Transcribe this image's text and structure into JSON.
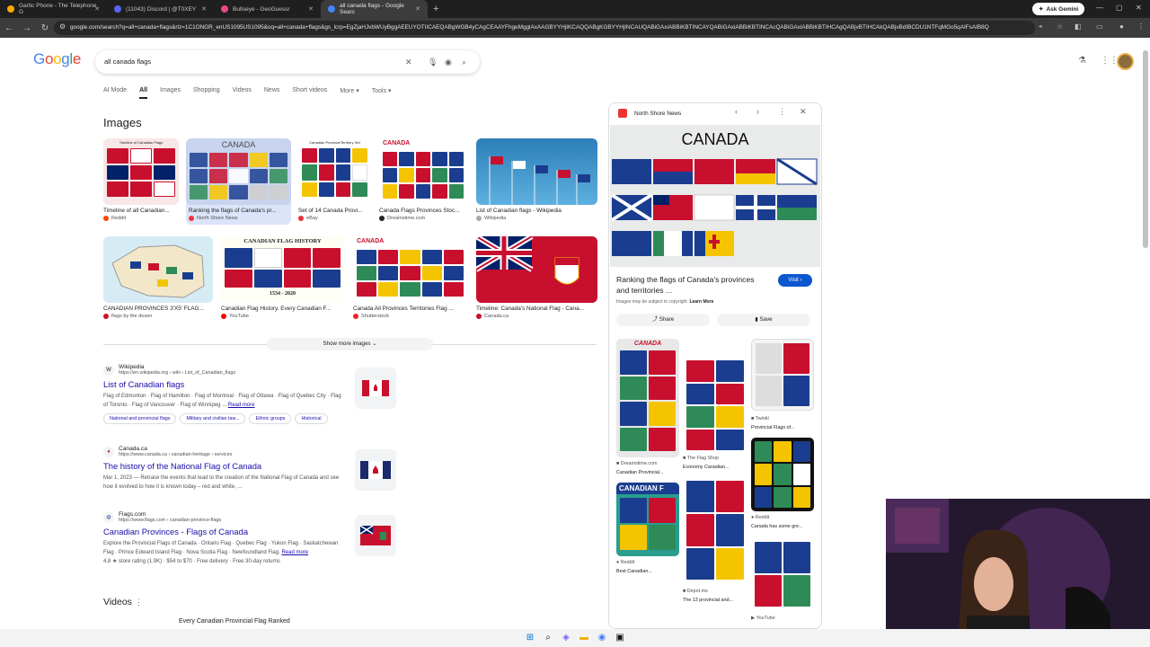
{
  "browser": {
    "tabs": [
      {
        "label": "Gartic Phone - The Telephone G",
        "color": "#f9ab00"
      },
      {
        "label": "(11043) Discord | @T0XEY",
        "color": "#5865f2"
      },
      {
        "label": "Bullseye - GeoGuessr",
        "color": "#e8488a"
      },
      {
        "label": "all canada flags - Google Searc",
        "color": "#4285f4"
      }
    ],
    "new_tab": "+",
    "ask_gemini": "Ask Gemini",
    "url": "google.com/search?q=all+canada+flags&rlz=1C1ONGR_enUS1095US1095&oq=all+canada+flags&gs_lcrp=EgZjaHJvbWUyBggAEEUYOTIICAEQABgWGB4yCAgCEAAYFhgeMgglAxAAGBYYHjIKCAQQABgKGBYYHjINCAUQABiGAxiABBiKBTINCAYQABiGAxiABBiKBTINCAcQABiGAxiABBiKBTIHCAgQABjvBTIHCAkQABjvBdIBCDU1NTFqMGo5qAIFsAIB8Q"
  },
  "google": {
    "logo": [
      "G",
      "o",
      "o",
      "g",
      "l",
      "e"
    ],
    "search_value": "all canada flags",
    "nav": [
      "AI Mode",
      "All",
      "Images",
      "Shopping",
      "Videos",
      "News",
      "Short videos",
      "More",
      "Tools"
    ],
    "images_heading": "Images",
    "image_results": [
      {
        "caption": "Timeline of all Canadian...",
        "source": "Reddit"
      },
      {
        "caption": "Ranking the flags of Canada's pr...",
        "source": "North Shore News"
      },
      {
        "caption": "Set of 14 Canada Provi...",
        "source": "eBay"
      },
      {
        "caption": "Canada Flags Provinces Stoc...",
        "source": "Dreamstime.com"
      },
      {
        "caption": "List of Canadian flags - Wikipedia",
        "source": "Wikipedia"
      },
      {
        "caption": "CANADIAN PROVINCES 3'X5' FLAG...",
        "source": "flags by the dozen"
      },
      {
        "caption": "Canadian Flag History. Every Canadian F...",
        "source": "YouTube"
      },
      {
        "caption": "Canada All Provinces Territories Flag ...",
        "source": "Shutterstock"
      },
      {
        "caption": "Timeline: Canada's National Flag - Cana...",
        "source": "Canada.ca"
      }
    ],
    "thumb_text": {
      "canada": "CANADA",
      "timeline": "Timeline of Canadian Flags",
      "set14": "Canadian Province/Territory Set",
      "history": "CANADIAN FLAG HISTORY",
      "years": "1534 - 2020"
    },
    "show_more": "Show more images",
    "results": [
      {
        "site": "Wikipedia",
        "url": "https://en.wikipedia.org › wiki › List_of_Canadian_flags",
        "title": "List of Canadian flags",
        "snippet": "Flag of Edmonton · Flag of Hamilton · Flag of Montreal · Flag of Ottawa · Flag of Quebec City · Flag of Toronto · Flag of Vancouver · Flag of Winnipeg ...",
        "read_more": "Read more",
        "chips": [
          "National and provincial flags",
          "Military and civilian law...",
          "Ethnic groups",
          "Historical"
        ]
      },
      {
        "site": "Canada.ca",
        "url": "https://www.canada.ca › canadian-heritage › services",
        "title": "The history of the National Flag of Canada",
        "snippet": "Mar 1, 2023 — Retrace the events that lead to the creation of the National Flag of Canada and see how it evolved to how it is known today – red and white, ..."
      },
      {
        "site": "Flags.com",
        "url": "https://www.flags.com › canadian-province-flags",
        "title": "Canadian Provinces - Flags of Canada",
        "snippet": "Explore the Provincial Flags of Canada · Ontario Flag · Quebec Flag · Yukon Flag · Saskatchewan Flag · Prince Edward Island Flag · Nova Scotia Flag · Newfoundland Flag.",
        "read_more": "Read more",
        "rating": "4.8 ★ store rating (1.9K) · $54 to $70 · Free delivery · Free 30-day returns"
      }
    ],
    "videos_heading": "Videos",
    "video_title": "Every Canadian Provincial Flag Ranked"
  },
  "panel": {
    "source": "North Shore News",
    "image_title": "CANADA",
    "title": "Ranking the flags of Canada's provinces and territories ...",
    "visit": "Visit",
    "copyright": "Images may be subject to copyright.",
    "learn_more": "Learn More",
    "share": "Share",
    "save": "Save",
    "more": [
      {
        "source": "Dreamstime.com",
        "caption": "Canadian Provincial..."
      },
      {
        "source": "The Flag Shop",
        "caption": "Economy Canadian..."
      },
      {
        "source": "Twinkl",
        "caption": "Provincial Flags of..."
      },
      {
        "source": "Reddit",
        "caption": "Canada has some gre..."
      },
      {
        "source": "Reddit",
        "caption": "Best Canadian..."
      },
      {
        "source": "Depot.ms",
        "caption": "The 13 provincial and..."
      },
      {
        "source": "YouTube",
        "caption": ""
      }
    ],
    "canadian_banner": "CANADIAN F",
    "canada_banner": "CANADA"
  }
}
